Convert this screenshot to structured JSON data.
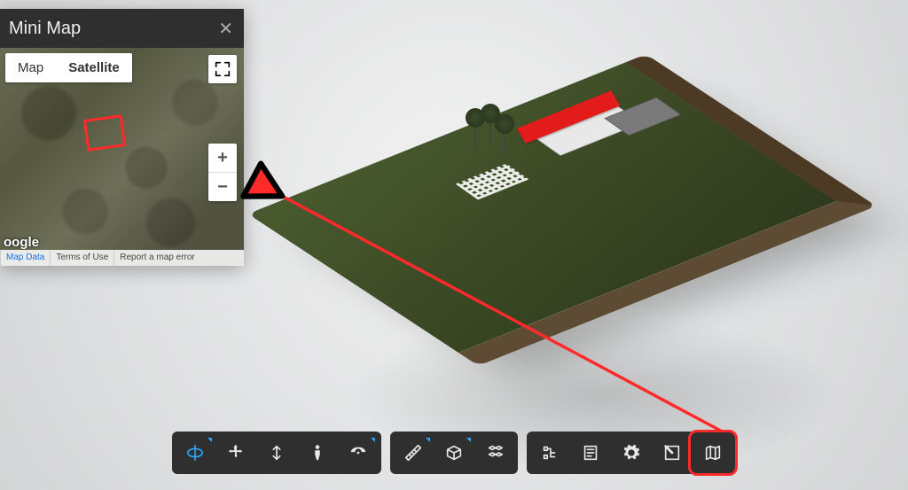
{
  "minimap": {
    "title": "Mini Map",
    "tab_map": "Map",
    "tab_satellite": "Satellite",
    "logo": "oogle",
    "footer_mapdata": "Map Data",
    "footer_terms": "Terms of Use",
    "footer_report": "Report a map error",
    "zoom_in": "+",
    "zoom_out": "−"
  },
  "toolbar": {
    "orbit": "orbit",
    "pan": "pan",
    "zoom": "zoom",
    "walk": "first-person",
    "cam": "camera",
    "measure": "measure",
    "section": "section",
    "explode": "explode",
    "tree": "model-browser",
    "props": "properties",
    "settings": "settings",
    "fullscreen": "fullscreen",
    "map": "mini-map"
  }
}
